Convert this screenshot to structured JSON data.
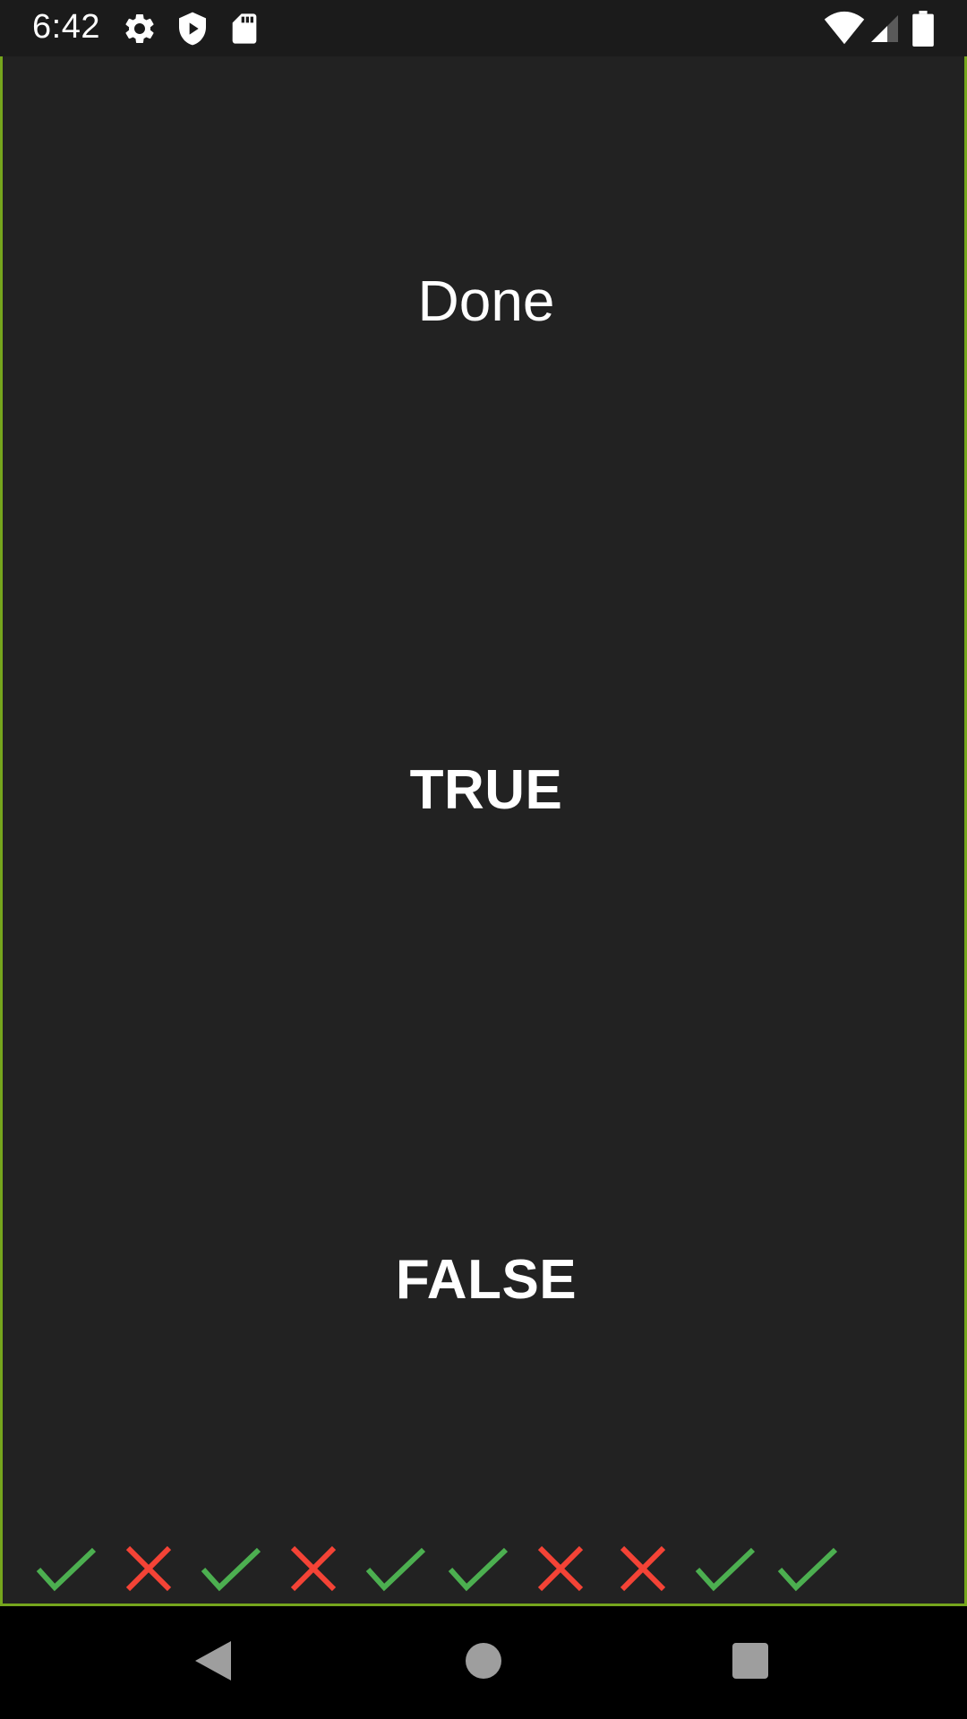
{
  "status_bar": {
    "time": "6:42",
    "left_icons": [
      "gear-icon",
      "shield-play-icon",
      "sd-card-icon"
    ],
    "right_icons": [
      "wifi-icon",
      "cell-signal-icon",
      "battery-icon"
    ]
  },
  "main": {
    "title": "Done",
    "true_label": "TRUE",
    "false_label": "FALSE"
  },
  "results": [
    {
      "correct": true,
      "icon": "check-icon"
    },
    {
      "correct": false,
      "icon": "cross-icon"
    },
    {
      "correct": true,
      "icon": "check-icon"
    },
    {
      "correct": false,
      "icon": "cross-icon"
    },
    {
      "correct": true,
      "icon": "check-icon"
    },
    {
      "correct": true,
      "icon": "check-icon"
    },
    {
      "correct": false,
      "icon": "cross-icon"
    },
    {
      "correct": false,
      "icon": "cross-icon"
    },
    {
      "correct": true,
      "icon": "check-icon"
    },
    {
      "correct": true,
      "icon": "check-icon"
    }
  ],
  "nav_bar": {
    "buttons": [
      "back-icon",
      "home-icon",
      "recents-icon"
    ]
  },
  "colors": {
    "background": "#222222",
    "border_accent": "#76a61d",
    "correct": "#4caf50",
    "incorrect": "#f44336",
    "text": "#ffffff",
    "nav_icon": "#9e9e9e"
  }
}
